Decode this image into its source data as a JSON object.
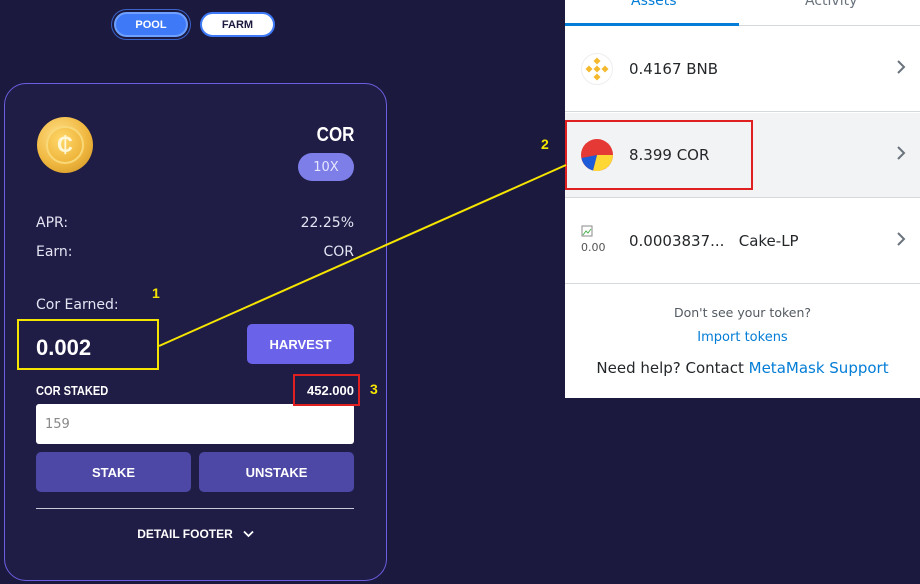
{
  "toggles": {
    "pool": "POOL",
    "farm": "FARM"
  },
  "pool_card": {
    "token": "COR",
    "multiplier": "10X",
    "apr_label": "APR:",
    "apr_value": "22.25%",
    "earn_label": "Earn:",
    "earn_value": "COR",
    "earned_label": "Cor Earned:",
    "earned_value": "0.002",
    "harvest_label": "HARVEST",
    "staked_label": "COR STAKED",
    "staked_value": "452.000",
    "input_value": "159",
    "stake_label": "STAKE",
    "unstake_label": "UNSTAKE",
    "footer_label": "DETAIL FOOTER"
  },
  "annotations": {
    "n1": "1",
    "n2": "2",
    "n3": "3",
    "color_yellow": "#f5e400",
    "color_red": "#e02020"
  },
  "wallet": {
    "tabs": {
      "assets": "Assets",
      "activity": "Activity"
    },
    "assets": [
      {
        "text": "0.4167 BNB",
        "icon": "bnb-icon"
      },
      {
        "text": "8.399 COR",
        "icon": "cor-icon"
      },
      {
        "amount": "0.0003837...",
        "symbol": "Cake-LP",
        "icon": "broken-image-icon",
        "icon_alt": "0.00"
      }
    ],
    "help_question": "Don't see your token?",
    "import_link": "Import tokens",
    "need_help": "Need help? Contact ",
    "support_link": "MetaMask Support"
  }
}
